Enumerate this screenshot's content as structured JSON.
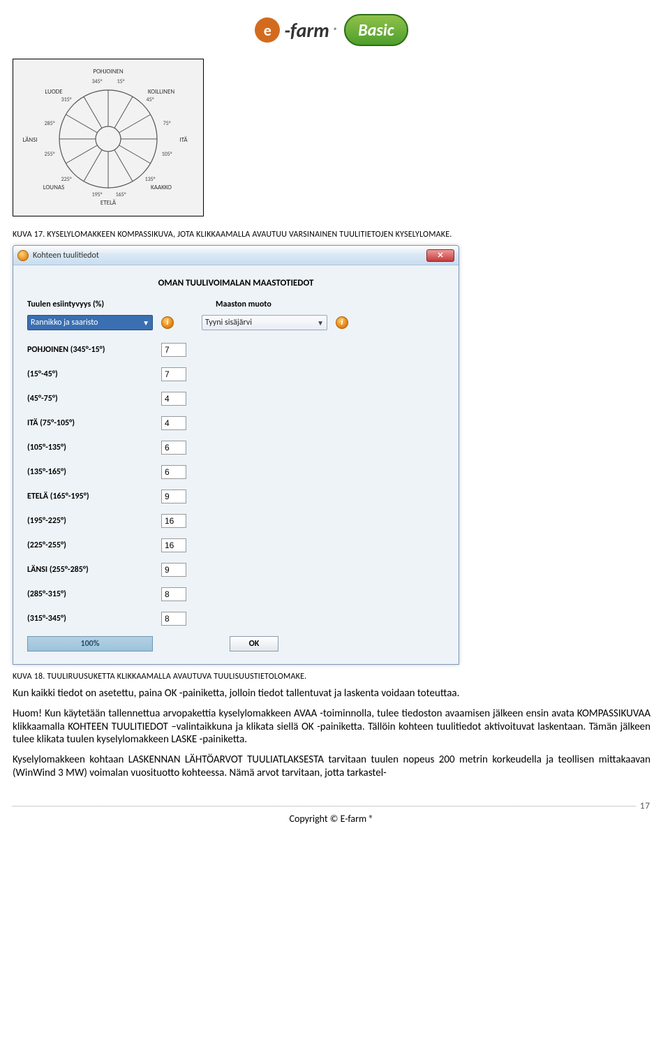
{
  "logo": {
    "brand": "-farm",
    "reg": "®",
    "basic": "Basic",
    "e": "e"
  },
  "compass": {
    "labels": {
      "n": "POHJOINEN",
      "ne": "KOILLINEN",
      "e": "ITÄ",
      "se": "KAAKKO",
      "s": "ETELÄ",
      "sw": "LOUNAS",
      "w": "LÄNSI",
      "nw": "LUODE"
    },
    "degrees": [
      "345°",
      "15°",
      "45°",
      "75°",
      "105°",
      "135°",
      "165°",
      "195°",
      "225°",
      "255°",
      "285°",
      "315°"
    ]
  },
  "caption17": "KUVA 17. KYSELYLOMAKKEEN KOMPASSIKUVA, JOTA KLIKKAAMALLA AVAUTUU VARSINAINEN TUULITIETOJEN KYSELYLOMAKE.",
  "dialog": {
    "title": "Kohteen tuulitiedot",
    "section": "OMAN TUULIVOIMALAN MAASTOTIEDOT",
    "col1": "Tuulen esiintyvyys (%)",
    "col2": "Maaston muoto",
    "select1": "Rannikko ja saaristo",
    "select2": "Tyyni sisäjärvi",
    "directions": [
      {
        "label": "POHJOINEN (345°-15°)",
        "value": "7"
      },
      {
        "label": "(15°-45°)",
        "value": "7"
      },
      {
        "label": "(45°-75°)",
        "value": "4"
      },
      {
        "label": "ITÄ (75°-105°)",
        "value": "4"
      },
      {
        "label": "(105°-135°)",
        "value": "6"
      },
      {
        "label": "(135°-165°)",
        "value": "6"
      },
      {
        "label": "ETELÄ (165°-195°)",
        "value": "9"
      },
      {
        "label": "(195°-225°)",
        "value": "16"
      },
      {
        "label": "(225°-255°)",
        "value": "16"
      },
      {
        "label": "LÄNSI (255°-285°)",
        "value": "9"
      },
      {
        "label": "(285°-315°)",
        "value": "8"
      },
      {
        "label": "(315°-345°)",
        "value": "8"
      }
    ],
    "sum": "100%",
    "ok": "OK",
    "close": "✕"
  },
  "caption18": "KUVA 18. TUULIRUUSUKETTA KLIKKAAMALLA AVAUTUVA TUULISUUSTIETOLOMAKE.",
  "para1": "Kun kaikki tiedot on asetettu, paina OK -painiketta, jolloin tiedot tallentuvat ja laskenta voidaan toteuttaa.",
  "para2": "Huom! Kun käytetään tallennettua arvopakettia kyselylomakkeen AVAA -toiminnolla, tulee tiedoston avaamisen jälkeen ensin avata KOMPASSIKUVAA klikkaamalla KOHTEEN TUULITIEDOT –valintaikkuna ja klikata siellä OK -painiketta. Tällöin kohteen tuulitiedot aktivoituvat laskentaan. Tämän jälkeen tulee klikata tuulen kyselylomakkeen LASKE -painiketta.",
  "para3": "Kyselylomakkeen kohtaan LASKENNAN LÄHTÖARVOT TUULIATLAKSESTA tarvitaan tuulen nopeus 200 metrin korkeudella ja teollisen mittakaavan (WinWind 3 MW) voimalan vuosituotto kohteessa. Nämä arvot tarvitaan, jotta tarkastel-",
  "footer": {
    "page": "17",
    "copy": "Copyright © E-farm ®"
  }
}
